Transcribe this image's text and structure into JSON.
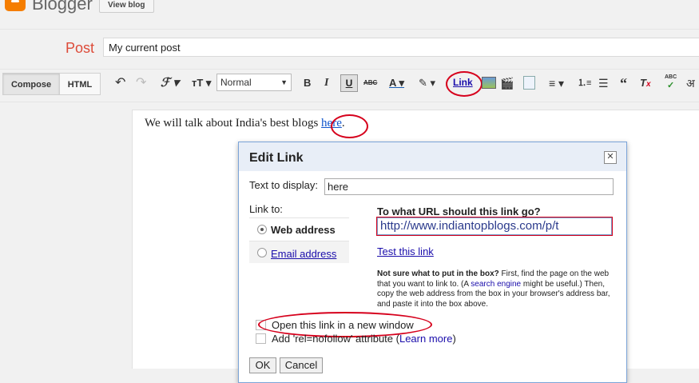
{
  "app": {
    "name": "Blogger",
    "view_blog": "View blog"
  },
  "post": {
    "label": "Post",
    "title_value": "My current post"
  },
  "toolbar": {
    "compose": "Compose",
    "html": "HTML",
    "font_style": "Normal",
    "bold": "B",
    "italic": "I",
    "underline": "U",
    "strike": "ABC",
    "link": "Link",
    "spellcheck": "ABC",
    "input_tools": "अ"
  },
  "editor": {
    "text_before": "We will talk about India's best blogs ",
    "link_text": "here",
    "text_after": "."
  },
  "dialog": {
    "title": "Edit Link",
    "close": "✕",
    "text_to_display_label": "Text to display:",
    "text_to_display_value": "here",
    "link_to_label": "Link to:",
    "options": [
      {
        "label": "Web address",
        "selected": true
      },
      {
        "label": "Email address",
        "selected": false
      }
    ],
    "url_prompt": "To what URL should this link go?",
    "url_value": "http://www.indiantopblogs.com/p/t",
    "test_link": "Test this link",
    "help_bold": "Not sure what to put in the box?",
    "help_1": " First, find the page on the web that you want to link to. (A ",
    "help_link": "search engine",
    "help_2": " might be useful.) Then, copy the web address from the box in your browser's address bar, and paste it into the box above.",
    "new_window_label": "Open this link in a new window",
    "nofollow_label": "Add 'rel=nofollow' attribute (",
    "learn_more": "Learn more",
    "nofollow_close": ")",
    "ok": "OK",
    "cancel": "Cancel"
  },
  "colors": {
    "accent": "#f57d00",
    "highlight": "#d6001c",
    "link": "#1a0dab"
  }
}
